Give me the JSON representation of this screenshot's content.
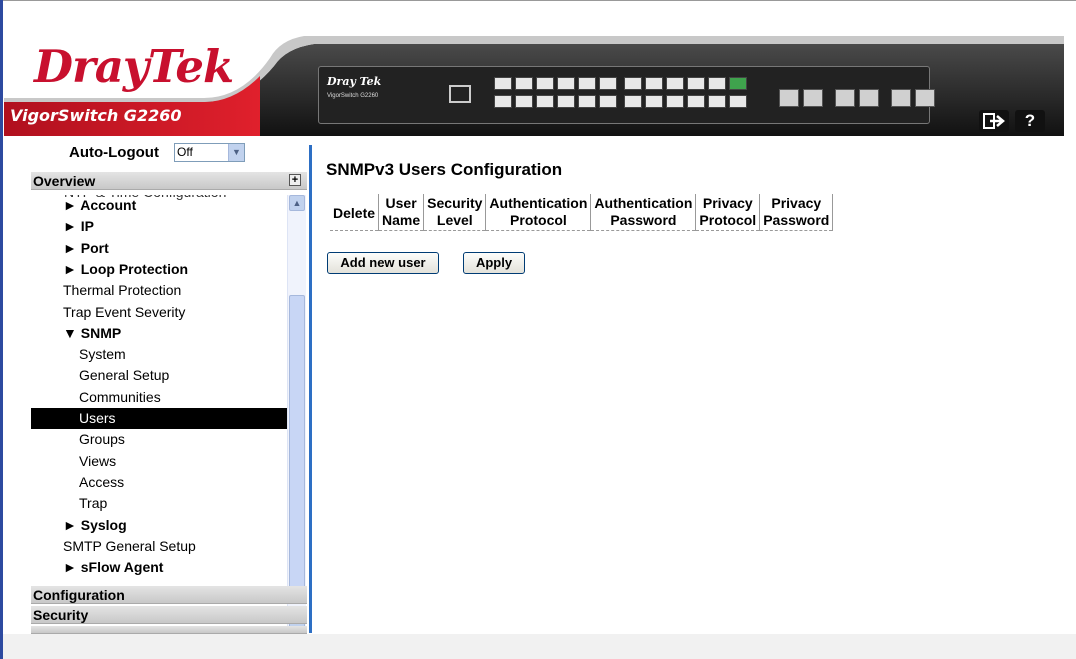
{
  "header": {
    "logo_text": "DrayTek",
    "product_name": "VigorSwitch G2260",
    "device_brand": "Dray Tek",
    "device_model": "VigorSwitch G2260",
    "logout_icon": "logout-arrow-icon",
    "help_label": "?"
  },
  "sidebar": {
    "auto_logout_label": "Auto-Logout",
    "auto_logout_value": "Off",
    "overview_label": "Overview",
    "partial_item": "NTP & Time Configuration",
    "items": [
      {
        "label": "► Account",
        "bold": true,
        "indent": 1
      },
      {
        "label": "► IP",
        "bold": true,
        "indent": 1
      },
      {
        "label": "► Port",
        "bold": true,
        "indent": 1
      },
      {
        "label": "► Loop Protection",
        "bold": true,
        "indent": 1
      },
      {
        "label": "Thermal Protection",
        "bold": false,
        "indent": 1
      },
      {
        "label": "Trap Event Severity",
        "bold": false,
        "indent": 1
      },
      {
        "label": "▼ SNMP",
        "bold": true,
        "indent": 1
      },
      {
        "label": "System",
        "bold": false,
        "indent": 2
      },
      {
        "label": "General Setup",
        "bold": false,
        "indent": 2
      },
      {
        "label": "Communities",
        "bold": false,
        "indent": 2
      },
      {
        "label": "Users",
        "bold": false,
        "indent": 2,
        "selected": true
      },
      {
        "label": "Groups",
        "bold": false,
        "indent": 2
      },
      {
        "label": "Views",
        "bold": false,
        "indent": 2
      },
      {
        "label": "Access",
        "bold": false,
        "indent": 2
      },
      {
        "label": "Trap",
        "bold": false,
        "indent": 2
      },
      {
        "label": "► Syslog",
        "bold": true,
        "indent": 1
      },
      {
        "label": "SMTP General Setup",
        "bold": false,
        "indent": 1
      },
      {
        "label": "► sFlow Agent",
        "bold": true,
        "indent": 1
      }
    ],
    "configuration_label": "Configuration",
    "security_label": "Security",
    "maintenance_partial": "Maintenance"
  },
  "main": {
    "title": "SNMPv3 Users Configuration",
    "columns": [
      [
        "Delete"
      ],
      [
        "User",
        "Name"
      ],
      [
        "Security",
        "Level"
      ],
      [
        "Authentication",
        "Protocol"
      ],
      [
        "Authentication",
        "Password"
      ],
      [
        "Privacy",
        "Protocol"
      ],
      [
        "Privacy",
        "Password"
      ]
    ],
    "add_button": "Add new user",
    "apply_button": "Apply"
  },
  "colors": {
    "brand_red": "#c8102e",
    "accent_blue": "#2d6fc4",
    "selected_bg": "#000000"
  }
}
